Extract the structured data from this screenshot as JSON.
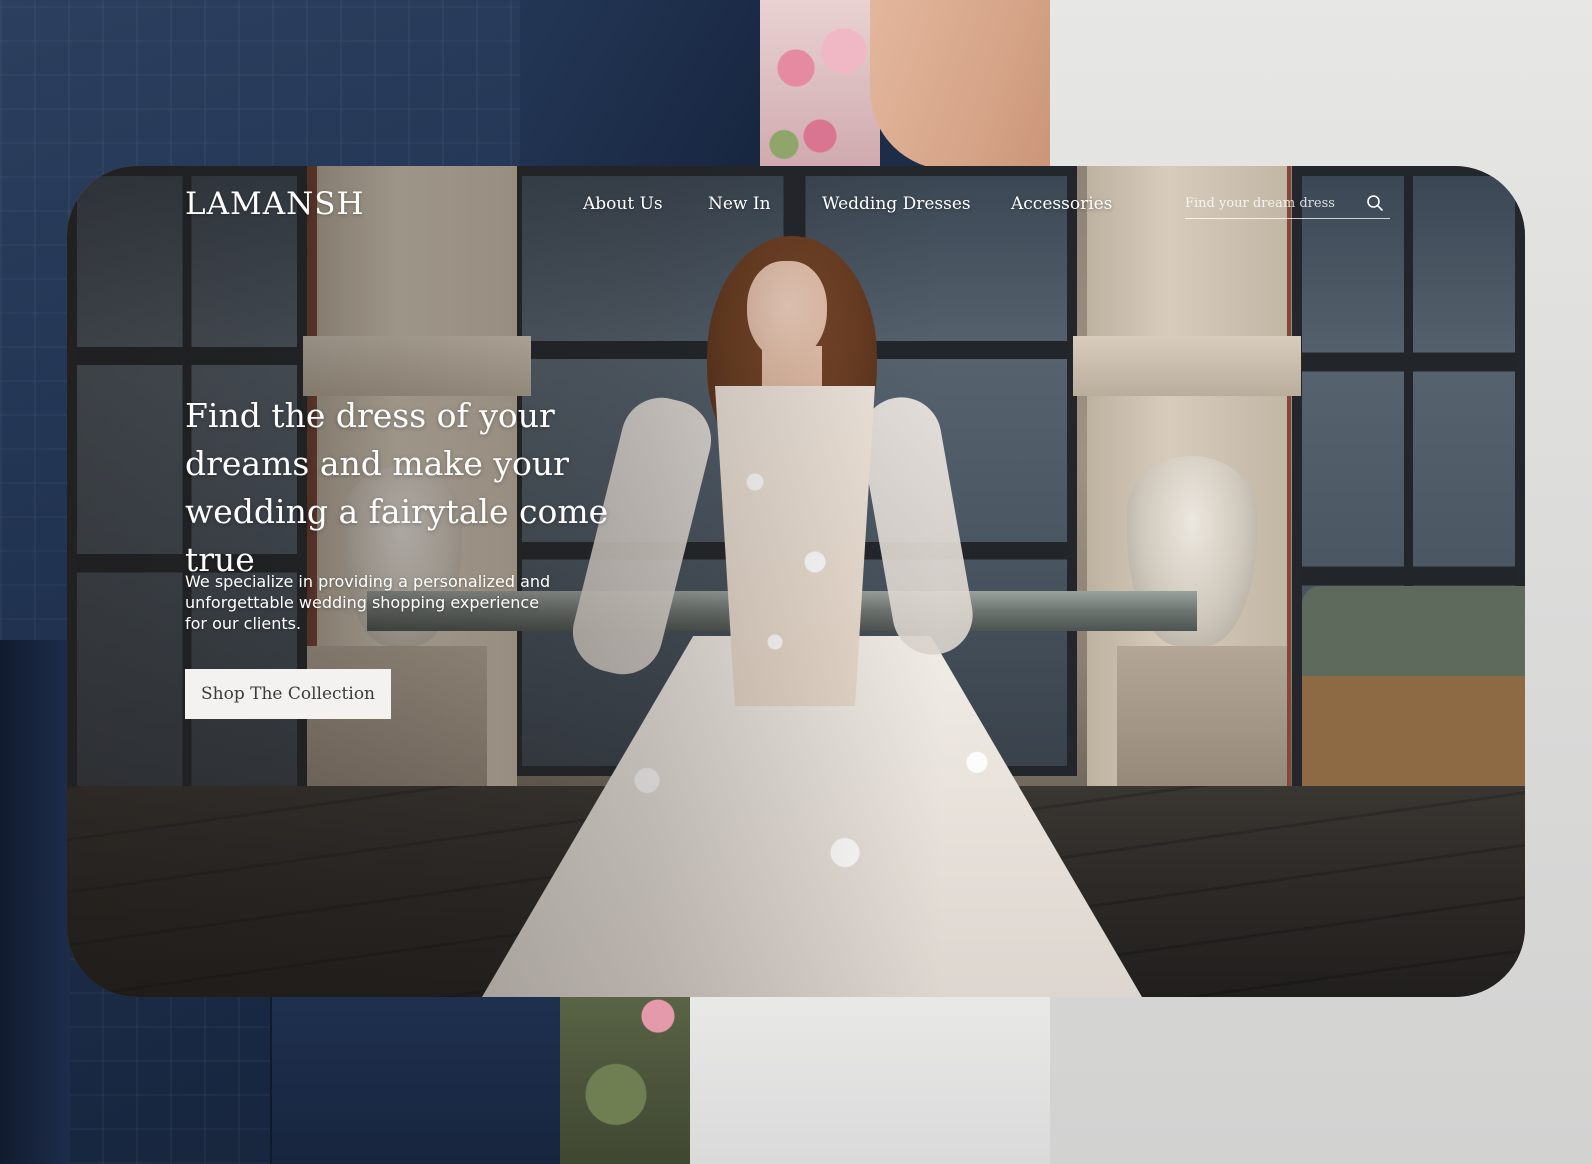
{
  "brand": {
    "logo": "LAMANSH"
  },
  "nav": {
    "items": [
      {
        "label": "About Us"
      },
      {
        "label": "New In"
      },
      {
        "label": "Wedding Dresses"
      },
      {
        "label": "Accessories"
      }
    ]
  },
  "search": {
    "placeholder": "Find your dream dress",
    "icon": "search-icon"
  },
  "hero": {
    "headline": "Find the dress of your dreams and make your wedding a fairytale come true",
    "subtext": "We specialize in providing a personalized and unforgettable wedding shopping experience for our clients.",
    "cta_label": "Shop The Collection"
  },
  "colors": {
    "text": "#ffffff",
    "button_bg": "#f4f2f0",
    "button_text": "#3b3b3b",
    "backdrop_navy": "#1d2c47"
  }
}
